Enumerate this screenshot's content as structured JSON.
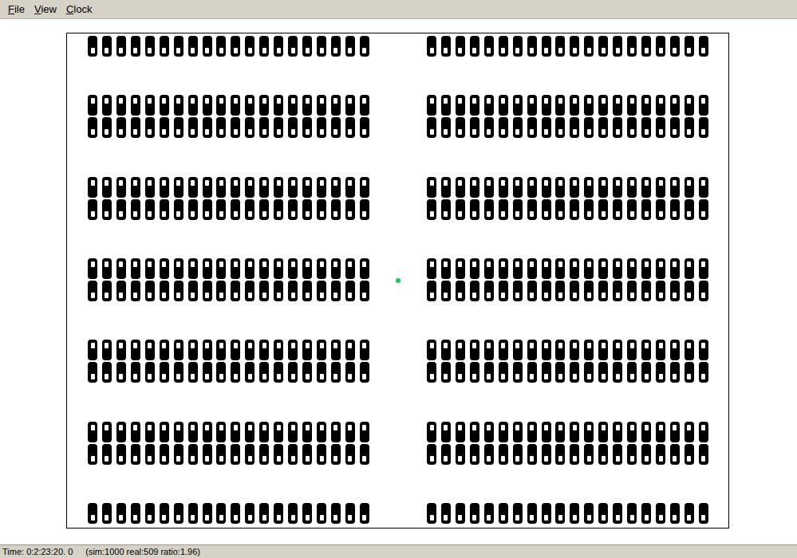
{
  "menu": [
    {
      "label": "File",
      "mnemonic_index": 0
    },
    {
      "label": "View",
      "mnemonic_index": 0
    },
    {
      "label": "Clock",
      "mnemonic_index": 0
    }
  ],
  "lots": [
    {
      "side": "left",
      "groups": [
        {
          "rows": [
            {
              "facing": "down",
              "cars": 20
            }
          ]
        },
        {
          "rows": [
            {
              "facing": "up",
              "cars": 20
            },
            {
              "facing": "down",
              "cars": 20
            }
          ]
        },
        {
          "rows": [
            {
              "facing": "up",
              "cars": 20
            },
            {
              "facing": "down",
              "cars": 20
            }
          ]
        },
        {
          "rows": [
            {
              "facing": "up",
              "cars": 20
            },
            {
              "facing": "down",
              "cars": 20
            }
          ]
        },
        {
          "rows": [
            {
              "facing": "up",
              "cars": 20
            },
            {
              "facing": "down",
              "cars": 20
            }
          ]
        },
        {
          "rows": [
            {
              "facing": "up",
              "cars": 20
            },
            {
              "facing": "down",
              "cars": 20
            }
          ]
        },
        {
          "rows": [
            {
              "facing": "down",
              "cars": 20
            }
          ]
        }
      ]
    },
    {
      "side": "right",
      "groups": [
        {
          "rows": [
            {
              "facing": "down",
              "cars": 20
            }
          ]
        },
        {
          "rows": [
            {
              "facing": "up",
              "cars": 20
            },
            {
              "facing": "down",
              "cars": 20
            }
          ]
        },
        {
          "rows": [
            {
              "facing": "up",
              "cars": 20
            },
            {
              "facing": "down",
              "cars": 20
            }
          ]
        },
        {
          "rows": [
            {
              "facing": "up",
              "cars": 20
            },
            {
              "facing": "down",
              "cars": 20
            }
          ]
        },
        {
          "rows": [
            {
              "facing": "up",
              "cars": 20
            },
            {
              "facing": "down",
              "cars": 20
            }
          ]
        },
        {
          "rows": [
            {
              "facing": "up",
              "cars": 20
            },
            {
              "facing": "down",
              "cars": 20
            }
          ]
        },
        {
          "rows": [
            {
              "facing": "down",
              "cars": 20
            }
          ]
        }
      ]
    }
  ],
  "agent": {
    "color": "#22c55e"
  },
  "status_bar": {
    "time": "Time: 0:2:23:20. 0",
    "ratio": "(sim:1000 real:509 ratio:1.96)"
  }
}
